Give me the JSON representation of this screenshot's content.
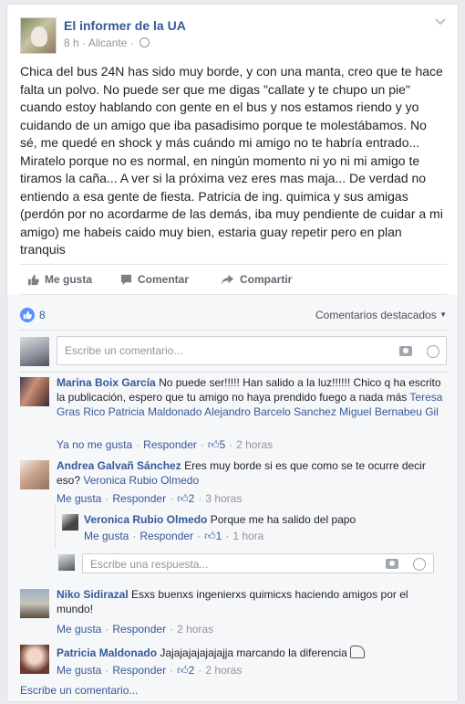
{
  "post": {
    "page_name": "El informer de la UA",
    "time": "8 h",
    "location": "Alicante",
    "text": "Chica del bus 24N has sido muy borde, y con una manta, creo que te hace falta un polvo. No puede ser que me digas \"callate y te chupo un pie\" cuando estoy hablando con gente en el bus y nos estamos riendo y yo cuidando de un amigo que iba pasadisimo porque te molestábamos. No sé, me quedé en shock y más cuándo mi amigo no te habría entrado... Miratelo porque no es normal, en ningún momento ni yo ni mi amigo te tiramos la caña... A ver si la próxima vez eres mas maja... De verdad no entiendo a esa gente de fiesta. Patricia de ing. quimica y sus amigas (perdón por no acordarme de las demás, iba muy pendiente de cuidar a mi amigo) me habeis caido muy bien, estaria guay repetir pero en plan tranquis"
  },
  "actions": {
    "like": "Me gusta",
    "comment": "Comentar",
    "share": "Compartir"
  },
  "reactions": {
    "count": "8",
    "sort_label": "Comentarios destacados"
  },
  "comment_input": {
    "placeholder": "Escribe un comentario..."
  },
  "reply_input": {
    "placeholder": "Escribe una respuesta..."
  },
  "comments": [
    {
      "author": "Marina Boix García",
      "text": "No puede ser!!!!! Han salido a la luz!!!!!! Chico q ha escrito la publicación, espero que tu amigo no haya prendido fuego a nada más",
      "tags": "Teresa Gras Rico Patricia Maldonado Alejandro Barcelo Sanchez Miguel Bernabeu Gil",
      "like_label": "Ya no me gusta",
      "reply_label": "Responder",
      "likes": "5",
      "time": "2 horas"
    },
    {
      "author": "Andrea Galvañ Sánchez",
      "text": "Eres muy borde si es que como se te ocurre decir eso?",
      "tags": "Veronica Rubio Olmedo",
      "like_label": "Me gusta",
      "reply_label": "Responder",
      "likes": "2",
      "time": "3 horas"
    },
    {
      "author": "Niko Sidirazal",
      "text": "Esxs buenxs ingenierxs quimicxs haciendo amigos por el mundo!",
      "like_label": "Me gusta",
      "reply_label": "Responder",
      "time": "2 horas"
    },
    {
      "author": "Patricia Maldonado",
      "text": "Jajajajajajajajja marcando la diferencia",
      "like_label": "Me gusta",
      "reply_label": "Responder",
      "likes": "2",
      "time": "2 horas"
    }
  ],
  "reply": {
    "author": "Veronica Rubio Olmedo",
    "text": "Porque me ha salido del papo",
    "like_label": "Me gusta",
    "reply_label": "Responder",
    "likes": "1",
    "time": "1 hora"
  },
  "write_comment": "Escribe un comentario..."
}
